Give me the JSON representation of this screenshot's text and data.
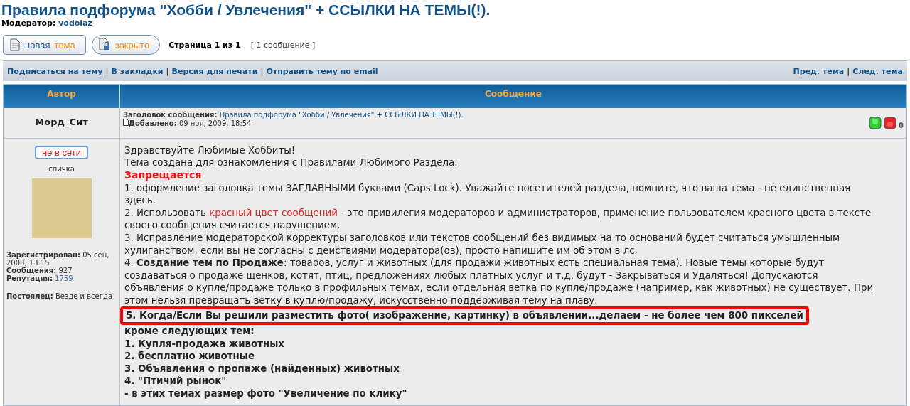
{
  "title": "Правила подфорума \"Хобби / Увлечения\" + ССЫЛКИ НА ТЕМЫ(!).",
  "moderator": {
    "label": "Модератор:",
    "name": "vodolaz"
  },
  "action_buttons": [
    {
      "kind": "new",
      "parts": [
        {
          "text": "новая",
          "accent": false
        },
        {
          "text": "тема",
          "accent": true
        }
      ]
    },
    {
      "kind": "locked",
      "parts": [
        {
          "text": "закрыто",
          "accent": true
        }
      ]
    }
  ],
  "pagination": {
    "pages": "Страница 1 из 1",
    "count": "[ 1 сообщение ]"
  },
  "link_separator": "|",
  "topic_links": [
    "Подписаться на тему",
    "В закладки",
    "Версия для печати",
    "Отправить тему по email"
  ],
  "nav_links": [
    "Пред. тема",
    "След. тема"
  ],
  "columns": [
    "Автор",
    "Сообщение"
  ],
  "post": {
    "author": "Морд_Сит",
    "subject_label": "Заголовок сообщения:",
    "subject": "Правила подфорума \"Хобби / Увлечения\" + ССЫЛКИ НА ТЕМЫ(!).",
    "added_label": "Добавлено:",
    "date": "09 ноя, 2009, 18:54",
    "karma": "0",
    "status": "не в сети",
    "rank": "спичка",
    "profile": [
      {
        "label": "Зарегистрирован:",
        "value": "05 сен, 2008, 13:15",
        "kind": "plain"
      },
      {
        "label": "Сообщения:",
        "value": "927",
        "kind": "plain"
      },
      {
        "label": "Репутация:",
        "value": "1759",
        "kind": "link"
      }
    ],
    "location": {
      "label": "Постоялец:",
      "value": "Везде и всегда"
    },
    "body": [
      {
        "kind": "normal",
        "segments": [
          {
            "kind": "plain",
            "text": "Здравствуйте Любимые Хоббиты!"
          }
        ]
      },
      {
        "kind": "normal",
        "segments": [
          {
            "kind": "plain",
            "text": "Тема создана для ознакомления с Правилами Любимого Раздела."
          }
        ]
      },
      {
        "kind": "heading",
        "segments": [
          {
            "kind": "plain",
            "text": "Запрещается"
          }
        ]
      },
      {
        "kind": "normal",
        "segments": [
          {
            "kind": "plain",
            "text": "1. оформление заголовка темы ЗАГЛАВНЫМИ буквами (Caps Lock). Уважайте посетителей раздела, помните, что ваша тема - не единственная здесь."
          }
        ]
      },
      {
        "kind": "normal",
        "segments": [
          {
            "kind": "plain",
            "text": "2. Использовать "
          },
          {
            "kind": "red",
            "text": "красный цвет сообщений"
          },
          {
            "kind": "plain",
            "text": " - это привилегия модераторов и администраторов, применение пользователем красного цвета в тексте своего сообщения считается нарушением."
          }
        ]
      },
      {
        "kind": "normal",
        "segments": [
          {
            "kind": "plain",
            "text": "3. Исправление модераторской корректуры заголовков или текстов сообщений без видимых на то оснований будет считаться умышленным хулиганством, если вы не согласны с действиями модератора(ов), просто напишите им об этом в лс."
          }
        ]
      },
      {
        "kind": "normal",
        "segments": [
          {
            "kind": "plain",
            "text": "4. "
          },
          {
            "kind": "bold",
            "text": "Создание тем по Продаже"
          },
          {
            "kind": "plain",
            "text": ": товаров, услуг и животных (для продажи животных есть специальная тема). Новые темы которые будут создаваться о продаже щенков, котят, птиц, предложениях любых платных услуг и т.д. будут - Закрываться и Удаляться! Допускаются объявления о купле/продаже только в профильных темах, если отдельная ветка по купле/продаже (например, как животных) не существует. При этом нельзя превращать ветку в куплю/продажу, искусственно поддерживая тему на плаву."
          }
        ]
      },
      {
        "kind": "highlight",
        "segments": [
          {
            "kind": "plain",
            "text": "5. Когда/Если Вы решили разместить фото( изображение, картинку) в объявлении...делаем - не более чем 800 пикселей"
          }
        ]
      },
      {
        "kind": "bold",
        "segments": [
          {
            "kind": "plain",
            "text": "кроме следующих тем:"
          }
        ]
      },
      {
        "kind": "bold",
        "segments": [
          {
            "kind": "plain",
            "text": "1. Купля-продажа животных"
          }
        ]
      },
      {
        "kind": "bold",
        "segments": [
          {
            "kind": "plain",
            "text": "2. бесплатно животные"
          }
        ]
      },
      {
        "kind": "bold",
        "segments": [
          {
            "kind": "plain",
            "text": "3. Объявления о пропаже (найденных) животных"
          }
        ]
      },
      {
        "kind": "bold",
        "segments": [
          {
            "kind": "plain",
            "text": "4. \"Птичий рынок\""
          }
        ]
      },
      {
        "kind": "bold",
        "segments": [
          {
            "kind": "plain",
            "text": "- в этих темах размер фото \"Увеличение по клику\""
          }
        ]
      }
    ]
  }
}
